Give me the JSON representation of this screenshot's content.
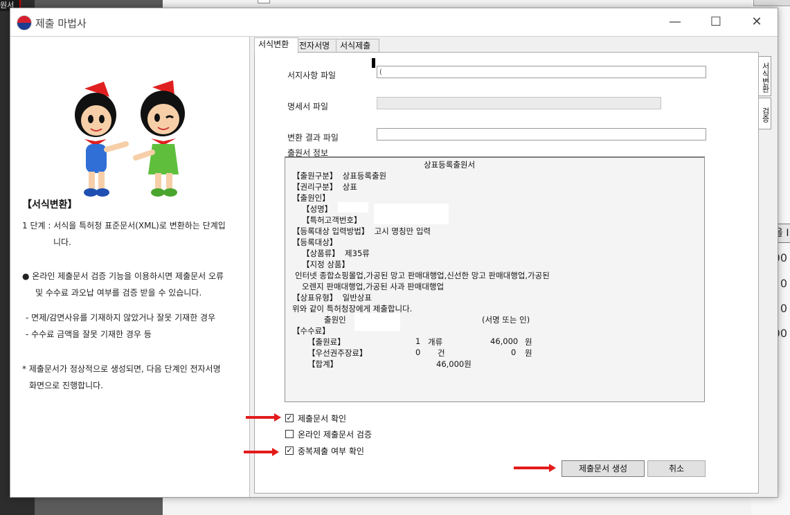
{
  "background": {
    "left_tab_label": "원서",
    "right_numbers": [
      "00",
      "0",
      "0",
      "00"
    ],
    "right_button_label": "을 I"
  },
  "window": {
    "title": "제출 마법사",
    "app_icon": "taegeuk-icon",
    "controls": {
      "minimize": "—",
      "maximize": "☐",
      "close": "✕"
    }
  },
  "left_panel": {
    "heading": "【서식변환】",
    "step_line1": "1 단계 : 서식을 특허청 표준문서(XML)로 변환하는 단계입",
    "step_line2": "니다.",
    "bullet_line1": "● 온라인 제출문서 검증 기능을 이용하시면 제출문서 오류",
    "bullet_line2": "및 수수료 과오납 여부를 검증 받을 수 있습니다.",
    "dash_line1": "- 면제/감면사유를 기재하지 않았거나 잘못 기재한 경우",
    "dash_line2": "- 수수료 금액을 잘못 기재한 경우 등",
    "note_line1": "* 제출문서가 정상적으로 생성되면, 다음 단계인 전자서명",
    "note_line2": "화면으로 진행합니다."
  },
  "tabs": [
    "서식변환",
    "전자서명",
    "서식제출"
  ],
  "side_tabs": [
    "서식변환",
    "검증"
  ],
  "form": {
    "file1_label": "서지사항 파일",
    "file1_value": "(",
    "file2_label": "명세서 파일",
    "file2_value": "",
    "file3_label": "변환 결과 파일",
    "file3_value": "",
    "info_label": "출원서 정보"
  },
  "info": {
    "doc_title": "상표등록출원서",
    "app_type": "【출원구분】  상표등록출원",
    "right_type": "【권리구분】  상표",
    "applicant": "【출원인】",
    "name": "【성명】",
    "customer_no": "【특허고객번호】",
    "input_method": "【등록대상 입력방법】  고시 명칭만 입력",
    "target": "【등록대상】",
    "class": "【상품류】  제35류",
    "goods": "【지정 상품】",
    "goods_line1": "인터넷 종합쇼핑몰업,가공된 망고 판매대행업,신선한 망고 판매대행업,가공된",
    "goods_line2": "오렌지 판매대행업,가공된 사과 판매대행업",
    "trademark_type": "【상표유형】  일반상표",
    "submit_line": "위와 같이 특허청장에게 제출합니다.",
    "applicant_sign": "출원인",
    "sign_note": "(서명 또는 인)",
    "fee": "【수수료】",
    "fee1_name": "【출원료】",
    "fee1_qty": "1",
    "fee1_unit": "개류",
    "fee1_amt": "46,000",
    "fee1_won": "원",
    "fee2_name": "【우선권주장료】",
    "fee2_qty": "0",
    "fee2_unit": "건",
    "fee2_amt": "0",
    "fee2_won": "원",
    "total_name": "【합계】",
    "total_amt": "46,000원"
  },
  "checks": [
    {
      "label": "제출문서 확인",
      "checked": true
    },
    {
      "label": "온라인 제출문서 검증",
      "checked": false
    },
    {
      "label": "중복제출 여부 확인",
      "checked": true
    }
  ],
  "check_mark": "✓",
  "buttons": {
    "generate": "제출문서 생성",
    "cancel": "취소"
  },
  "colors": {
    "arrow": "#e31b1b",
    "accent": "#d6202f"
  }
}
